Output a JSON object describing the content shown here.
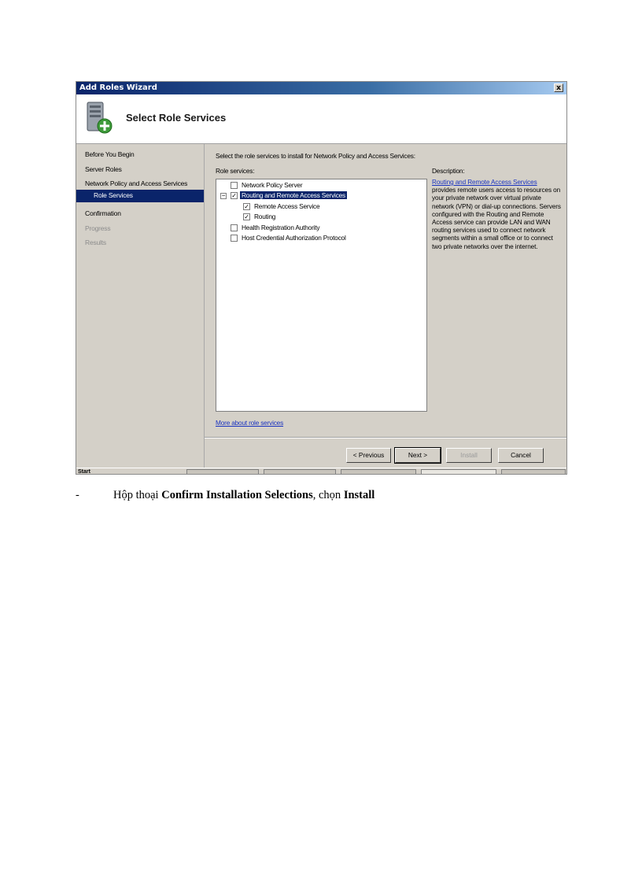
{
  "window": {
    "title": "Add Roles Wizard",
    "close_glyph": "x",
    "page_heading": "Select Role Services"
  },
  "sidebar": {
    "items": [
      {
        "label": "Before You Begin",
        "state": "normal"
      },
      {
        "label": "Server Roles",
        "state": "normal"
      },
      {
        "label": "Network Policy and Access Services",
        "state": "normal"
      },
      {
        "label": "Role Services",
        "state": "selected"
      },
      {
        "label": "Confirmation",
        "state": "normal"
      },
      {
        "label": "Progress",
        "state": "disabled"
      },
      {
        "label": "Results",
        "state": "disabled"
      }
    ]
  },
  "main": {
    "instruction": "Select the role services to install for Network Policy and Access Services:",
    "role_services_label": "Role services:",
    "description_label": "Description:",
    "tree": [
      {
        "label": "Network Policy Server",
        "checked": false,
        "level": 0
      },
      {
        "label": "Routing and Remote Access Services",
        "checked": true,
        "level": 0,
        "expanded": true,
        "selected": true
      },
      {
        "label": "Remote Access Service",
        "checked": true,
        "level": 1
      },
      {
        "label": "Routing",
        "checked": true,
        "level": 1
      },
      {
        "label": "Health Registration Authority",
        "checked": false,
        "level": 0
      },
      {
        "label": "Host Credential Authorization Protocol",
        "checked": false,
        "level": 0
      }
    ],
    "description_link": "Routing and Remote Access Services",
    "description_text": "provides remote users access to resources on your private network over virtual private network (VPN) or dial-up connections. Servers configured with the Routing and Remote Access service can provide LAN and WAN routing services used to connect network segments within a small office or to connect two private networks over the internet.",
    "more_link": "More about role services"
  },
  "buttons": {
    "previous": "< Previous",
    "next": "Next >",
    "install": "Install",
    "cancel": "Cancel"
  },
  "taskbar": {
    "start_label": "Start"
  },
  "caption": {
    "bullet": "-",
    "prefix": "Hộp thoại ",
    "dialog_name": "Confirm Installation Selections",
    "middle": ", chọn ",
    "action": "Install"
  }
}
